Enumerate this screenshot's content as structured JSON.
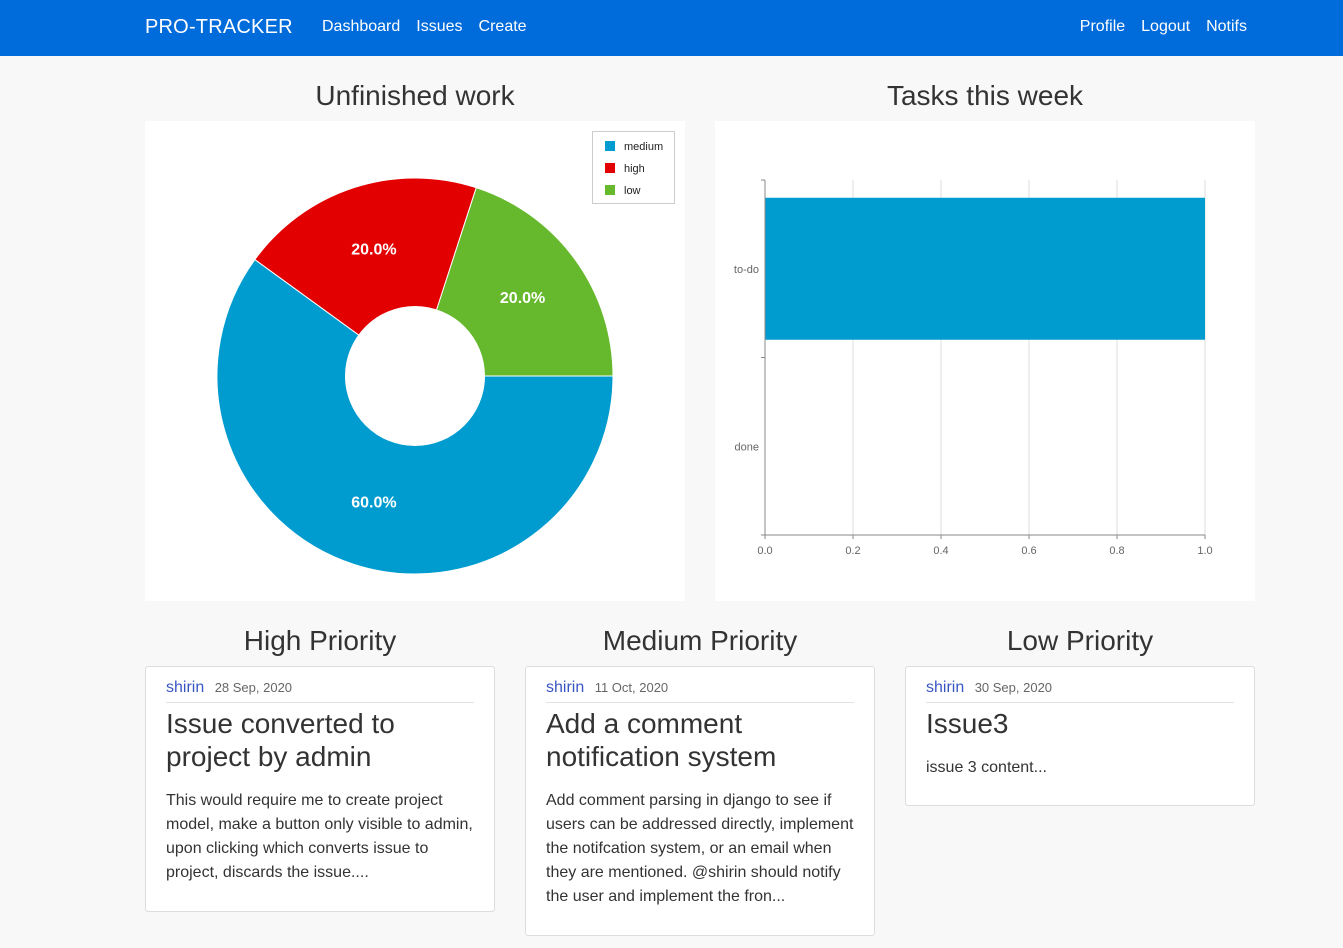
{
  "nav": {
    "brand": "PRO-TRACKER",
    "left": [
      "Dashboard",
      "Issues",
      "Create"
    ],
    "right": [
      "Profile",
      "Logout",
      "Notifs"
    ]
  },
  "charts": {
    "pie_title": "Unfinished work",
    "bar_title": "Tasks this week"
  },
  "chart_data": [
    {
      "type": "pie",
      "title": "Unfinished work",
      "donut": true,
      "legend": "top-right",
      "slices": [
        {
          "name": "medium",
          "value": 60.0,
          "label": "60.0%",
          "color": "#009ccf"
        },
        {
          "name": "high",
          "value": 20.0,
          "label": "20.0%",
          "color": "#e30000"
        },
        {
          "name": "low",
          "value": 20.0,
          "label": "20.0%",
          "color": "#66b82d"
        }
      ]
    },
    {
      "type": "bar",
      "orientation": "horizontal",
      "title": "Tasks this week",
      "categories": [
        "to-do",
        "done"
      ],
      "values": [
        1,
        0
      ],
      "xlim": [
        0,
        1.0
      ],
      "xticks": [
        "0.0",
        "0.2",
        "0.4",
        "0.6",
        "0.8",
        "1.0"
      ],
      "grid": true,
      "color": "#009ccf"
    }
  ],
  "priorities": [
    {
      "heading": "High Priority",
      "author": "shirin",
      "date": "28 Sep, 2020",
      "title": "Issue converted to project by admin",
      "body": "This would require me to create project model, make a button only visible to admin, upon clicking which converts issue to project, discards the issue...."
    },
    {
      "heading": "Medium Priority",
      "author": "shirin",
      "date": "11 Oct, 2020",
      "title": "Add a comment notification system",
      "body": "Add comment parsing in django to see if users can be addressed directly, implement the notifcation system, or an email when they are mentioned. @shirin should notify the user and implement the fron..."
    },
    {
      "heading": "Low Priority",
      "author": "shirin",
      "date": "30 Sep, 2020",
      "title": "Issue3",
      "body": "issue 3 content..."
    }
  ]
}
